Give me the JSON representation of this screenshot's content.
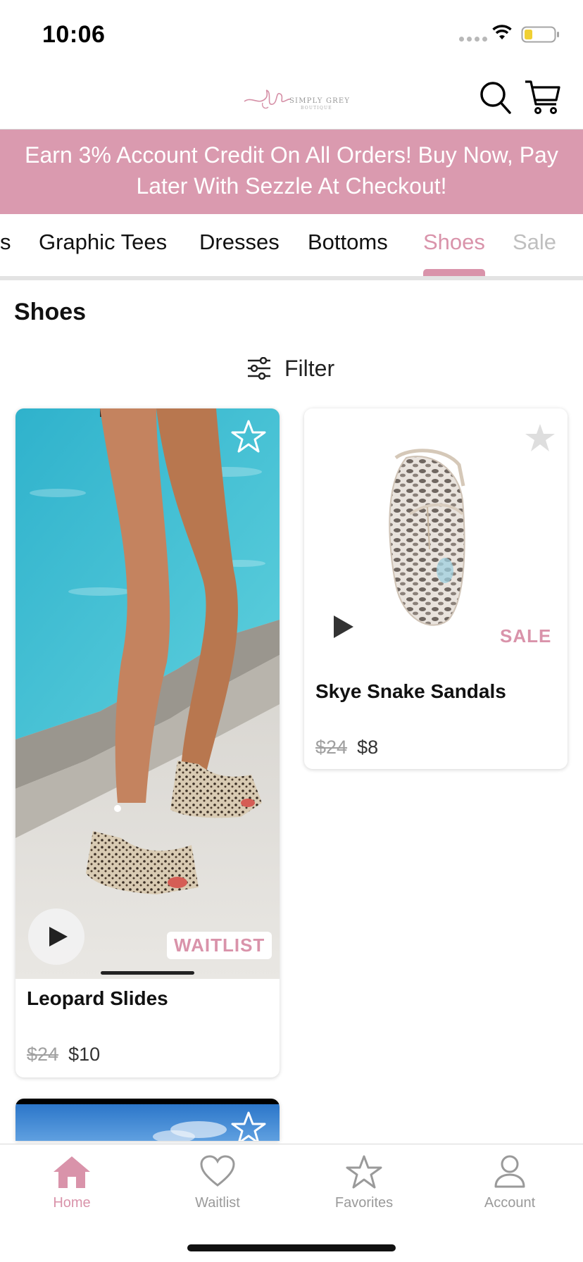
{
  "status_bar": {
    "time": "10:06"
  },
  "header": {
    "logo": {
      "monogram": "sg",
      "name": "SIMPLY GREY",
      "sub": "BOUTIQUE"
    }
  },
  "promo_banner": {
    "text": "Earn 3% Account Credit On All Orders! Buy Now, Pay Later With Sezzle At Checkout!"
  },
  "tabs": {
    "items": [
      {
        "label": "s"
      },
      {
        "label": "Graphic Tees"
      },
      {
        "label": "Dresses"
      },
      {
        "label": "Bottoms"
      },
      {
        "label": "Shoes"
      },
      {
        "label": "Sale"
      }
    ],
    "active_label": "Shoes"
  },
  "section": {
    "title": "Shoes"
  },
  "filter": {
    "label": "Filter"
  },
  "products": [
    {
      "name": "Leopard  Slides",
      "old_price": "$24",
      "new_price": "$10",
      "badge": "WAITLIST",
      "favorited": false,
      "video_progress": 0.35
    },
    {
      "name": "Skye Snake Sandals",
      "old_price": "$24",
      "new_price": "$8",
      "badge": "SALE",
      "favorited": false
    }
  ],
  "bottom_nav": {
    "items": [
      {
        "label": "Home",
        "icon": "home-icon",
        "active": true
      },
      {
        "label": "Waitlist",
        "icon": "heart-icon",
        "active": false
      },
      {
        "label": "Favorites",
        "icon": "star-icon",
        "active": false
      },
      {
        "label": "Account",
        "icon": "account-icon",
        "active": false
      }
    ]
  },
  "colors": {
    "accent": "#d993aa",
    "banner": "#da9aaf",
    "muted": "#9a9a9a"
  }
}
